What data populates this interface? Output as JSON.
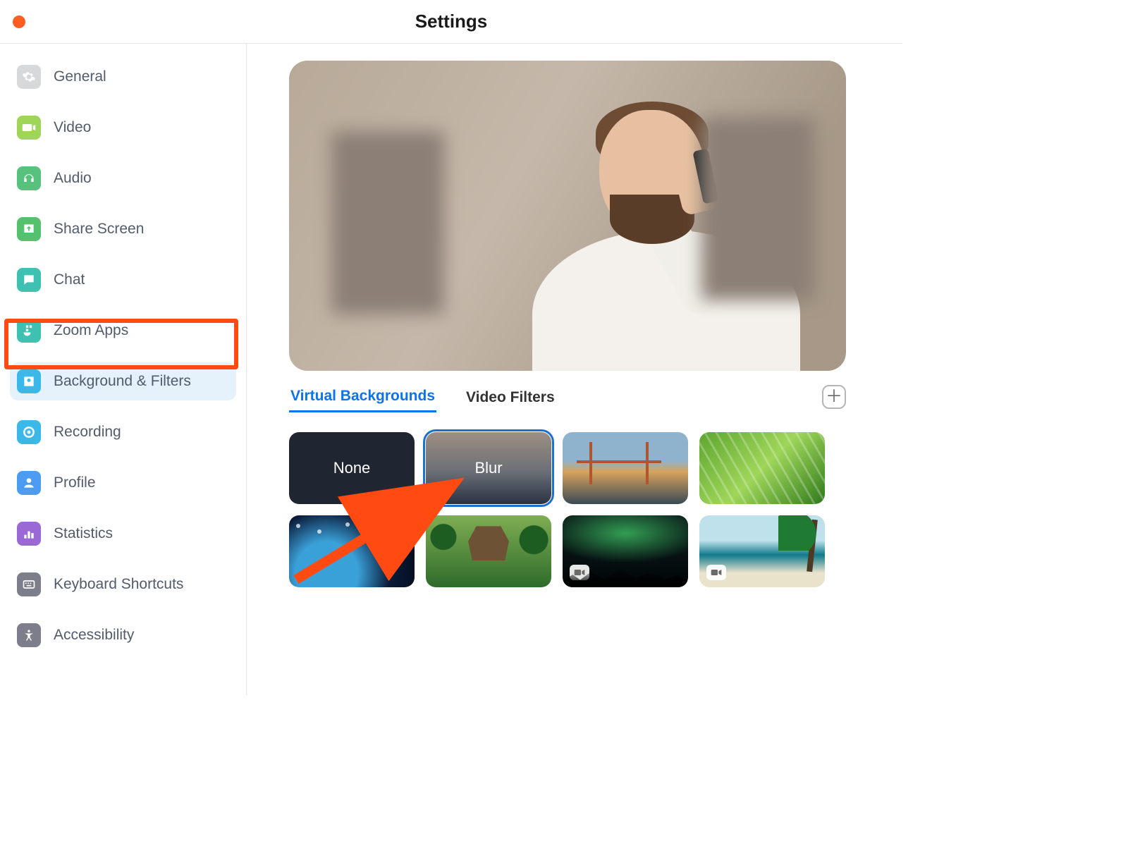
{
  "window": {
    "title": "Settings"
  },
  "sidebar": {
    "items": [
      {
        "label": "General"
      },
      {
        "label": "Video"
      },
      {
        "label": "Audio"
      },
      {
        "label": "Share Screen"
      },
      {
        "label": "Chat"
      },
      {
        "label": "Zoom Apps"
      },
      {
        "label": "Background & Filters"
      },
      {
        "label": "Recording"
      },
      {
        "label": "Profile"
      },
      {
        "label": "Statistics"
      },
      {
        "label": "Keyboard Shortcuts"
      },
      {
        "label": "Accessibility"
      }
    ],
    "selected_index": 6
  },
  "tabs": {
    "items": [
      {
        "label": "Virtual Backgrounds"
      },
      {
        "label": "Video Filters"
      }
    ],
    "active_index": 0
  },
  "backgrounds": {
    "selected_index": 1,
    "tiles": [
      {
        "label": "None",
        "kind": "none"
      },
      {
        "label": "Blur",
        "kind": "blur"
      },
      {
        "label": "",
        "kind": "bridge"
      },
      {
        "label": "",
        "kind": "grass"
      },
      {
        "label": "",
        "kind": "earth"
      },
      {
        "label": "",
        "kind": "jungle"
      },
      {
        "label": "",
        "kind": "aurora",
        "video": true
      },
      {
        "label": "",
        "kind": "beach",
        "video": true
      }
    ]
  },
  "annotation": {
    "highlight_sidebar_item_index": 6,
    "arrow_target": "blur-tile"
  }
}
